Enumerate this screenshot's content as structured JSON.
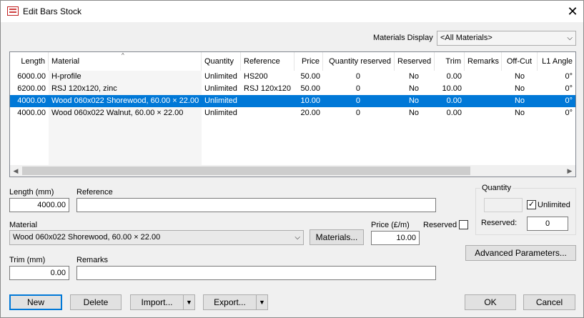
{
  "window": {
    "title": "Edit Bars Stock"
  },
  "materials_display": {
    "label": "Materials Display",
    "value": "<All Materials>"
  },
  "grid": {
    "columns": [
      "Length",
      "Material",
      "Quantity",
      "Reference",
      "Price",
      "Quantity reserved",
      "Reserved",
      "Trim",
      "Remarks",
      "Off-Cut",
      "L1 Angle"
    ],
    "rows": [
      {
        "length": "6000.00",
        "material": "H-profile",
        "quantity": "Unlimited",
        "reference": "HS200",
        "price": "50.00",
        "qty_reserved": "0",
        "reserved": "No",
        "trim": "0.00",
        "remarks": "",
        "offcut": "No",
        "l1_angle": "0°",
        "selected": false
      },
      {
        "length": "6200.00",
        "material": "RSJ 120x120, zinc",
        "quantity": "Unlimited",
        "reference": "RSJ 120x120",
        "price": "50.00",
        "qty_reserved": "0",
        "reserved": "No",
        "trim": "10.00",
        "remarks": "",
        "offcut": "No",
        "l1_angle": "0°",
        "selected": false
      },
      {
        "length": "4000.00",
        "material": "Wood 060x022 Shorewood, 60.00 × 22.00",
        "quantity": "Unlimited",
        "reference": "",
        "price": "10.00",
        "qty_reserved": "0",
        "reserved": "No",
        "trim": "0.00",
        "remarks": "",
        "offcut": "No",
        "l1_angle": "0°",
        "selected": true
      },
      {
        "length": "4000.00",
        "material": "Wood 060x022 Walnut, 60.00 × 22.00",
        "quantity": "Unlimited",
        "reference": "",
        "price": "20.00",
        "qty_reserved": "0",
        "reserved": "No",
        "trim": "0.00",
        "remarks": "",
        "offcut": "No",
        "l1_angle": "0°",
        "selected": false
      }
    ]
  },
  "form": {
    "length_label": "Length (mm)",
    "length_value": "4000.00",
    "reference_label": "Reference",
    "reference_value": "",
    "material_label": "Material",
    "material_value": "Wood 060x022 Shorewood, 60.00 × 22.00",
    "materials_button": "Materials...",
    "price_label": "Price (£/m)",
    "price_value": "10.00",
    "reserved_label": "Reserved",
    "trim_label": "Trim (mm)",
    "trim_value": "0.00",
    "remarks_label": "Remarks",
    "remarks_value": ""
  },
  "quantity_group": {
    "title": "Quantity",
    "quantity_value": "",
    "unlimited_label": "Unlimited",
    "unlimited_checked": true,
    "reserved_label": "Reserved:",
    "reserved_value": "0"
  },
  "buttons": {
    "advanced": "Advanced Parameters...",
    "new": "New",
    "delete": "Delete",
    "import": "Import...",
    "export": "Export...",
    "ok": "OK",
    "cancel": "Cancel"
  }
}
